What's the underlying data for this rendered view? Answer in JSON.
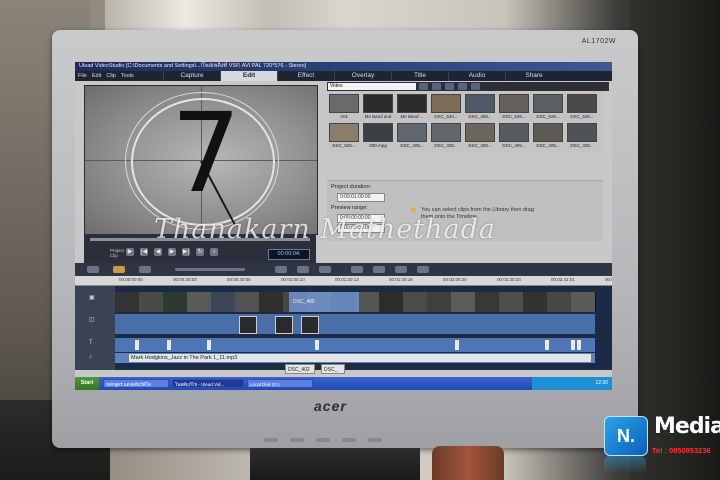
{
  "monitor": {
    "model": "AL1702W",
    "brand": "acer"
  },
  "app": {
    "title": "Ulead VideoStudio [C:\\Documents and Settings\\...\\โพสเพลิงท์  VSP, AVI PAL 720*576 - Stereo]",
    "menu": [
      "File",
      "Edit",
      "Clip",
      "Tools"
    ],
    "steps": [
      {
        "label": "Capture",
        "active": false
      },
      {
        "label": "Edit",
        "active": true
      },
      {
        "label": "Effect",
        "active": false
      },
      {
        "label": "Overlay",
        "active": false
      },
      {
        "label": "Title",
        "active": false
      },
      {
        "label": "Audio",
        "active": false
      },
      {
        "label": "Share",
        "active": false
      }
    ]
  },
  "preview": {
    "countdown": "7",
    "mode_label_1": "Project",
    "mode_label_2": "Clip",
    "timecode": "00:00:04:"
  },
  "library": {
    "category": "Video",
    "thumbs": [
      {
        "caption": "V01",
        "color": "#6a6a6a"
      },
      {
        "caption": "Me Band and",
        "color": "#2b2b2b"
      },
      {
        "caption": "Me Band ...",
        "color": "#2b2b2b"
      },
      {
        "caption": "DSC_534...",
        "color": "#7c6c58"
      },
      {
        "caption": "DSC_405...",
        "color": "#4f5a66"
      },
      {
        "caption": "DSC_526...",
        "color": "#65625c"
      },
      {
        "caption": "DSC_526...",
        "color": "#5a5f64"
      },
      {
        "caption": "DSC_526...",
        "color": "#4c4a48"
      },
      {
        "caption": "DSC_526...",
        "color": "#8a7d6a"
      },
      {
        "caption": "000.mpg",
        "color": "#3a3f46"
      },
      {
        "caption": "DSC_405...",
        "color": "#5e6670"
      },
      {
        "caption": "DSC_405...",
        "color": "#63686c"
      },
      {
        "caption": "DSC_405...",
        "color": "#6d655a"
      },
      {
        "caption": "DSC_405...",
        "color": "#575c61"
      },
      {
        "caption": "DSC_405...",
        "color": "#5d5a52"
      },
      {
        "caption": "DSC_405...",
        "color": "#4d5257"
      }
    ]
  },
  "options": {
    "project_duration_label": "Project duration:",
    "project_duration_value": "0:00:01:00:00",
    "preview_range_label": "Preview range:",
    "preview_start": "0:00:00:00:00",
    "preview_end": "0:00:00:00:00",
    "tip": "You can select clips from the Library then drag them onto the Timeline."
  },
  "watermark": "Thanakarn Mathethada",
  "timeline": {
    "ruler": [
      "00:00:00:00",
      "00:00:20:03",
      "00:00:40:06",
      "00:01:00:10",
      "00:01:20:13",
      "00:01:40:16",
      "00:02:00:20",
      "00:02:20:23",
      "00:02:41:01",
      "00:03:01:04"
    ],
    "selected_clip": "DSC_405",
    "music_clip": "Mark Hodgkins_Jazz in The Park 1_11.mp3",
    "audio_clips": [
      "DSC_402",
      "DSC_"
    ]
  },
  "taskbar": {
    "start": "Start",
    "tasks": [
      "หลักสูตร แต่งคลิปวีดีโอ",
      "โพสต์แก้ไข - Ulead Vid...",
      "Local Disk (D:)"
    ],
    "clock": "12:30"
  },
  "logo": {
    "badge": "N.",
    "name": "Media",
    "phone": "Tel : 0850853236"
  }
}
